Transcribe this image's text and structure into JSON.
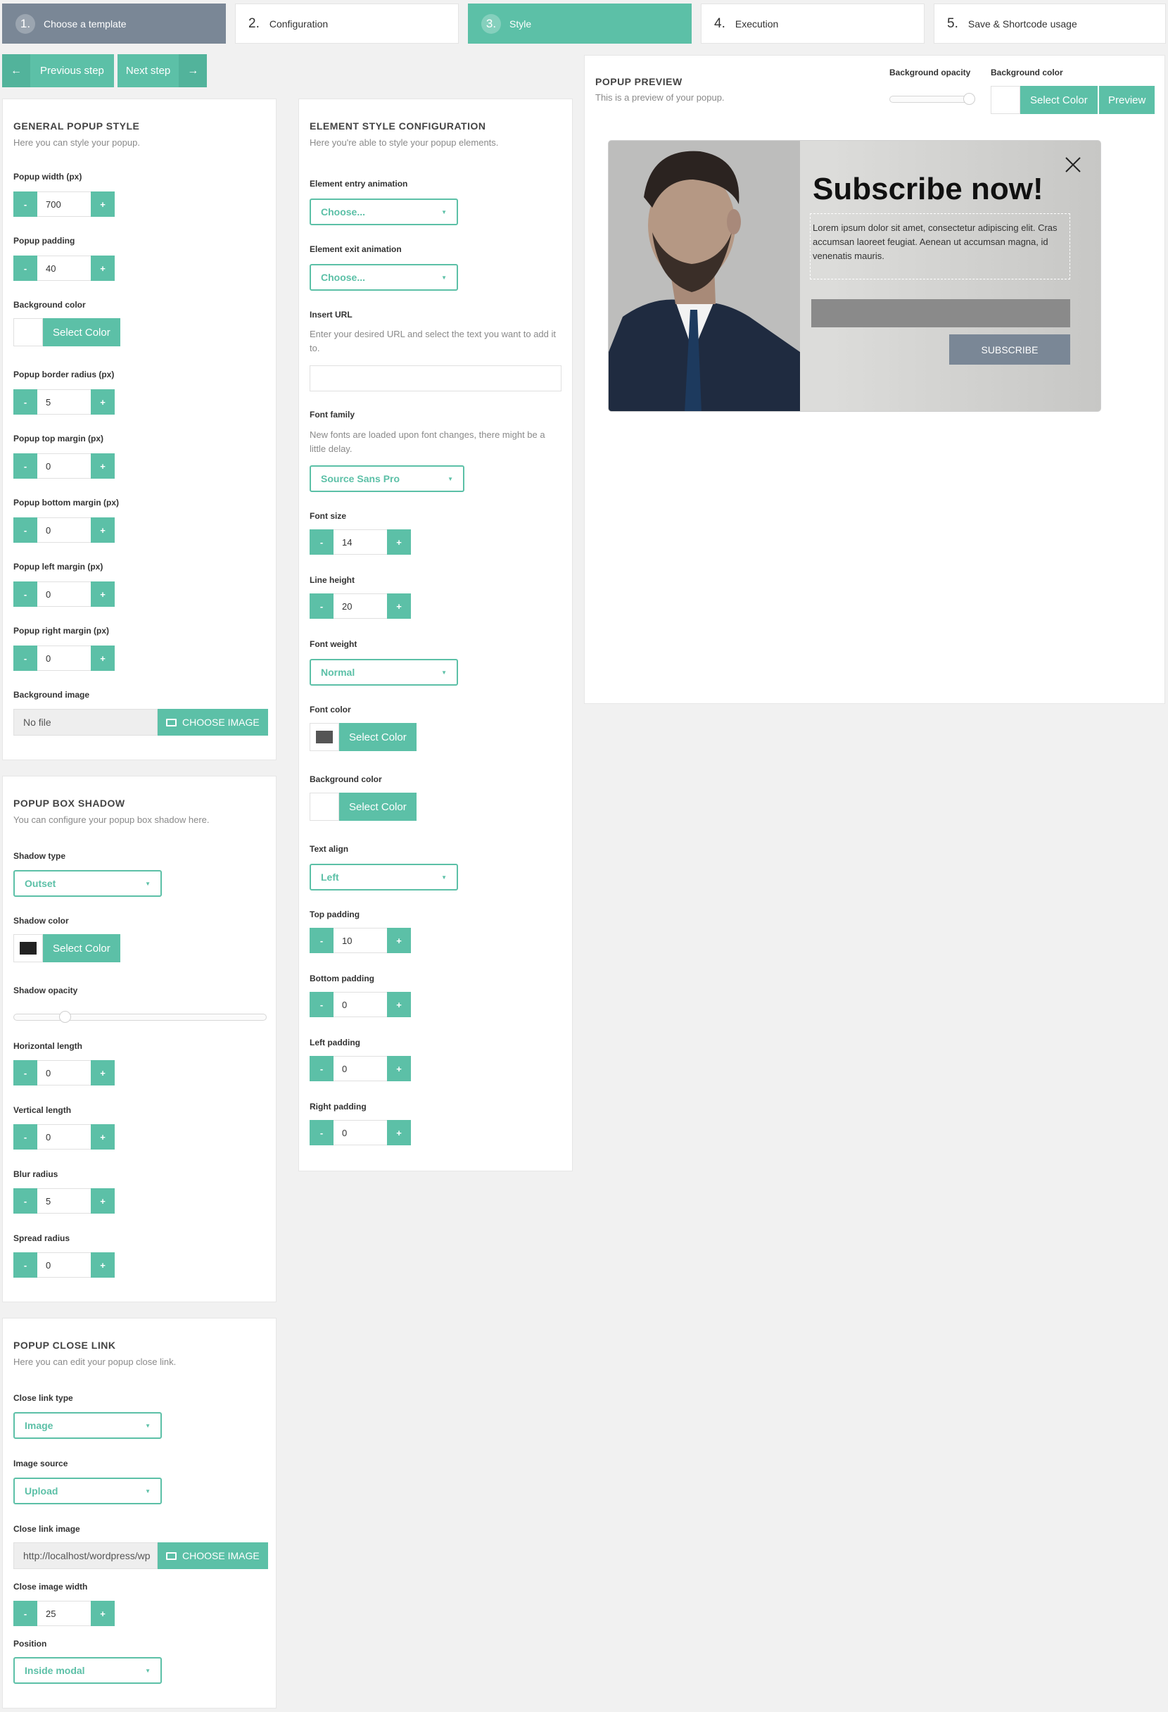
{
  "steps": [
    {
      "num": "1.",
      "label": "Choose a template"
    },
    {
      "num": "2.",
      "label": "Configuration"
    },
    {
      "num": "3.",
      "label": "Style"
    },
    {
      "num": "4.",
      "label": "Execution"
    },
    {
      "num": "5.",
      "label": "Save & Shortcode usage"
    }
  ],
  "nav": {
    "previous": "Previous step",
    "next": "Next step"
  },
  "general": {
    "title": "GENERAL POPUP STYLE",
    "subtitle": "Here you can style your popup.",
    "width_label": "Popup width (px)",
    "width": "700",
    "padding_label": "Popup padding",
    "padding": "40",
    "bg_label": "Background color",
    "select_color": "Select Color",
    "radius_label": "Popup border radius (px)",
    "radius": "5",
    "top_label": "Popup top margin (px)",
    "top": "0",
    "bottom_label": "Popup bottom margin (px)",
    "bottom": "0",
    "left_label": "Popup left margin (px)",
    "left": "0",
    "right_label": "Popup right margin (px)",
    "right": "0",
    "bgimage_label": "Background image",
    "bgimage_value": "No file",
    "choose_image": "CHOOSE IMAGE"
  },
  "shadow": {
    "title": "POPUP BOX SHADOW",
    "subtitle": "You can configure your popup box shadow here.",
    "type_label": "Shadow type",
    "type": "Outset",
    "color_label": "Shadow color",
    "select_color": "Select Color",
    "opacity_label": "Shadow opacity",
    "opacity": 0.2,
    "h_label": "Horizontal length",
    "h": "0",
    "v_label": "Vertical length",
    "v": "0",
    "blur_label": "Blur radius",
    "blur": "5",
    "spread_label": "Spread radius",
    "spread": "0"
  },
  "close": {
    "title": "POPUP CLOSE LINK",
    "subtitle": "Here you can edit your popup close link.",
    "type_label": "Close link type",
    "type": "Image",
    "source_label": "Image source",
    "source": "Upload",
    "image_label": "Close link image",
    "image_value": "http://localhost/wordpress/wp",
    "choose_image": "CHOOSE IMAGE",
    "width_label": "Close image width",
    "width": "25",
    "position_label": "Position",
    "position": "Inside modal"
  },
  "element": {
    "title": "ELEMENT STYLE CONFIGURATION",
    "subtitle": "Here you're able to style your popup elements.",
    "entry_label": "Element entry animation",
    "entry": "Choose...",
    "exit_label": "Element exit animation",
    "exit": "Choose...",
    "url_label": "Insert URL",
    "url_help": "Enter your desired URL and select the text you want to add it to.",
    "font_label": "Font family",
    "font_help": "New fonts are loaded upon font changes, there might be a little delay.",
    "font": "Source Sans Pro",
    "size_label": "Font size",
    "size": "14",
    "lh_label": "Line height",
    "lh": "20",
    "weight_label": "Font weight",
    "weight": "Normal",
    "fcolor_label": "Font color",
    "bgcolor_label": "Background color",
    "select_color": "Select Color",
    "align_label": "Text align",
    "align": "Left",
    "tpad_label": "Top padding",
    "tpad": "10",
    "bpad_label": "Bottom padding",
    "bpad": "0",
    "lpad_label": "Left padding",
    "lpad": "0",
    "rpad_label": "Right padding",
    "rpad": "0"
  },
  "preview": {
    "title": "POPUP PREVIEW",
    "subtitle": "This is a preview of your popup.",
    "opacity_label": "Background opacity",
    "opacity": 1.0,
    "bg_label": "Background color",
    "select_color": "Select Color",
    "preview_btn": "Preview",
    "heading": "Subscribe now!",
    "body": "Lorem ipsum dolor sit amet, consectetur adipiscing elit. Cras accumsan laoreet feugiat. Aenean ut accumsan magna, id venenatis mauris.",
    "button": "SUBSCRIBE"
  },
  "colors": {
    "accent": "#5cc0a7",
    "done": "#7a8796",
    "shadow_swatch": "#222222",
    "font_swatch": "#555555",
    "subscribe_btn": "#7a8796"
  }
}
